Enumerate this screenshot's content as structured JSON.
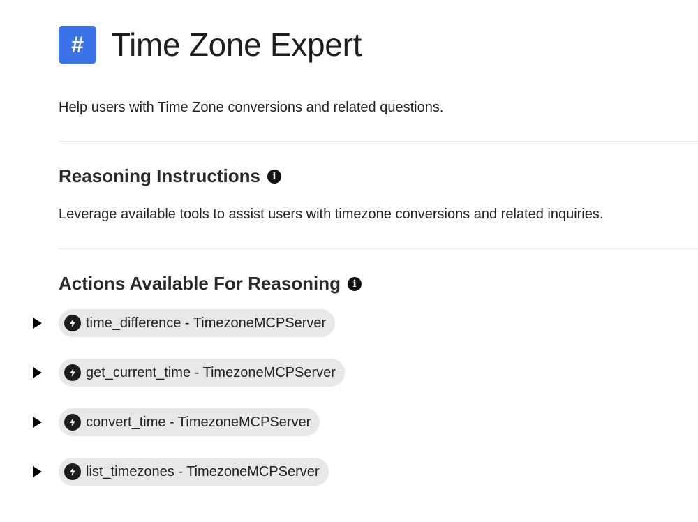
{
  "header": {
    "badge_symbol": "#",
    "title": "Time Zone Expert",
    "badge_color": "#3a72e8"
  },
  "description": "Help users with Time Zone conversions and related questions.",
  "reasoning_instructions": {
    "title": "Reasoning Instructions",
    "info_icon": "info-icon",
    "text": "Leverage available tools to assist users with timezone conversions and related inquiries."
  },
  "actions": {
    "title": "Actions Available For Reasoning",
    "info_icon": "info-icon",
    "items": [
      {
        "label": "time_difference - TimezoneMCPServer",
        "icon": "bolt-icon"
      },
      {
        "label": "get_current_time - TimezoneMCPServer",
        "icon": "bolt-icon"
      },
      {
        "label": "convert_time - TimezoneMCPServer",
        "icon": "bolt-icon"
      },
      {
        "label": "list_timezones - TimezoneMCPServer",
        "icon": "bolt-icon"
      }
    ]
  }
}
